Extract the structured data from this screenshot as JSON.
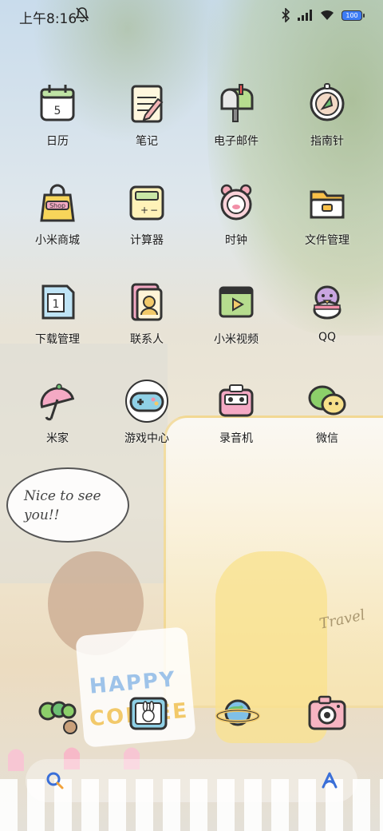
{
  "status_bar": {
    "time": "上午8:16",
    "battery": "100",
    "icons": [
      "do-not-disturb-icon",
      "bluetooth-icon",
      "signal-icon",
      "wifi-icon",
      "battery-icon"
    ]
  },
  "wallpaper": {
    "bubble_text": "Nice to see you!!",
    "sign_line1": "HAPPY",
    "sign_line2": "COFFEE",
    "bus_text": "Travel"
  },
  "apps": [
    {
      "id": "calendar",
      "label": "日历",
      "icon": "calendar-icon",
      "badge": "5"
    },
    {
      "id": "notes",
      "label": "笔记",
      "icon": "notes-icon"
    },
    {
      "id": "email",
      "label": "电子邮件",
      "icon": "mailbox-icon"
    },
    {
      "id": "compass",
      "label": "指南针",
      "icon": "compass-icon"
    },
    {
      "id": "mi-store",
      "label": "小米商城",
      "icon": "shopping-bag-icon",
      "badge": "Shop"
    },
    {
      "id": "calculator",
      "label": "计算器",
      "icon": "calculator-icon"
    },
    {
      "id": "clock",
      "label": "时钟",
      "icon": "clock-icon"
    },
    {
      "id": "file-manager",
      "label": "文件管理",
      "icon": "folder-icon"
    },
    {
      "id": "downloads",
      "label": "下载管理",
      "icon": "download-icon",
      "badge": "1"
    },
    {
      "id": "contacts",
      "label": "联系人",
      "icon": "contacts-icon"
    },
    {
      "id": "mi-video",
      "label": "小米视频",
      "icon": "video-icon"
    },
    {
      "id": "qq",
      "label": "QQ",
      "icon": "penguin-icon"
    },
    {
      "id": "mi-home",
      "label": "米家",
      "icon": "umbrella-icon"
    },
    {
      "id": "game-center",
      "label": "游戏中心",
      "icon": "gamepad-icon"
    },
    {
      "id": "recorder",
      "label": "录音机",
      "icon": "recorder-icon"
    },
    {
      "id": "wechat",
      "label": "微信",
      "icon": "wechat-icon"
    }
  ],
  "dock": [
    {
      "id": "dock-1",
      "icon": "caterpillar-icon"
    },
    {
      "id": "dock-2",
      "icon": "bunny-tv-icon"
    },
    {
      "id": "dock-3",
      "icon": "planet-icon"
    },
    {
      "id": "dock-4",
      "icon": "camera-icon"
    }
  ],
  "search": {
    "icon": "search-icon",
    "assistant_icon": "assistant-icon"
  }
}
